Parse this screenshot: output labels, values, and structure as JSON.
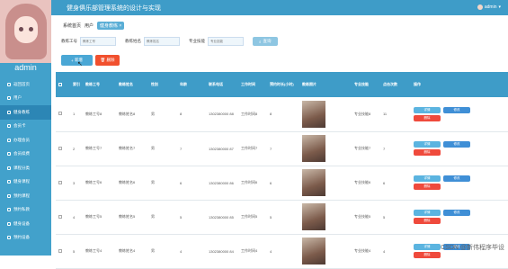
{
  "header": {
    "title": "健身俱乐部管理系统的设计与实现",
    "corner": "首页",
    "user": "admin"
  },
  "sidebar": {
    "admin_name": "admin",
    "items": [
      {
        "label": "返回首页"
      },
      {
        "label": "用户"
      },
      {
        "label": "健身教练"
      },
      {
        "label": "会员卡"
      },
      {
        "label": "办理会员"
      },
      {
        "label": "会员续费"
      },
      {
        "label": "课程分类"
      },
      {
        "label": "健身课程"
      },
      {
        "label": "预约课程"
      },
      {
        "label": "预约私教"
      },
      {
        "label": "健身设备"
      },
      {
        "label": "预约设备"
      }
    ]
  },
  "tabs": {
    "home": "系统首页",
    "user": "用户",
    "coach": "健身教练 ×"
  },
  "filters": {
    "coach_id_label": "教练工号",
    "coach_id_placeholder": "教练工号",
    "coach_name_label": "教练姓名",
    "coach_name_placeholder": "教练姓名",
    "skill_label": "专业技能",
    "skill_placeholder": "专业技能",
    "search": "查询"
  },
  "actions": {
    "add": "新增",
    "delete": "删除"
  },
  "table": {
    "headers": [
      "索引",
      "教练工号",
      "教练姓名",
      "性别",
      "年龄",
      "联系电话",
      "工作时间",
      "预约时长(小时)",
      "教练照片",
      "专业技能",
      "点击次数",
      "操作"
    ],
    "rows": [
      {
        "index": "1",
        "id": "教练工号8",
        "name": "教练姓名8",
        "gender": "男",
        "age": "8",
        "phone": "1302380000 88",
        "work": "工作时间8",
        "hours": "8",
        "skill": "专业技能8",
        "clicks": "11"
      },
      {
        "index": "2",
        "id": "教练工号7",
        "name": "教练姓名7",
        "gender": "男",
        "age": "7",
        "phone": "1302380000 87",
        "work": "工作时间7",
        "hours": "7",
        "skill": "专业技能7",
        "clicks": "7"
      },
      {
        "index": "3",
        "id": "教练工号6",
        "name": "教练姓名6",
        "gender": "男",
        "age": "6",
        "phone": "1302380000 86",
        "work": "工作时间6",
        "hours": "6",
        "skill": "专业技能6",
        "clicks": "6"
      },
      {
        "index": "4",
        "id": "教练工号5",
        "name": "教练姓名5",
        "gender": "男",
        "age": "5",
        "phone": "1302380000 85",
        "work": "工作时间5",
        "hours": "5",
        "skill": "专业技能5",
        "clicks": "5"
      },
      {
        "index": "5",
        "id": "教练工号4",
        "name": "教练姓名4",
        "gender": "男",
        "age": "4",
        "phone": "1302380000 84",
        "work": "工作时间4",
        "hours": "4",
        "skill": "专业技能4",
        "clicks": "4"
      }
    ],
    "ops": {
      "view": "详情",
      "edit": "修改",
      "delete": "删除"
    }
  },
  "watermark": "CSDN @新伟程序毕设"
}
